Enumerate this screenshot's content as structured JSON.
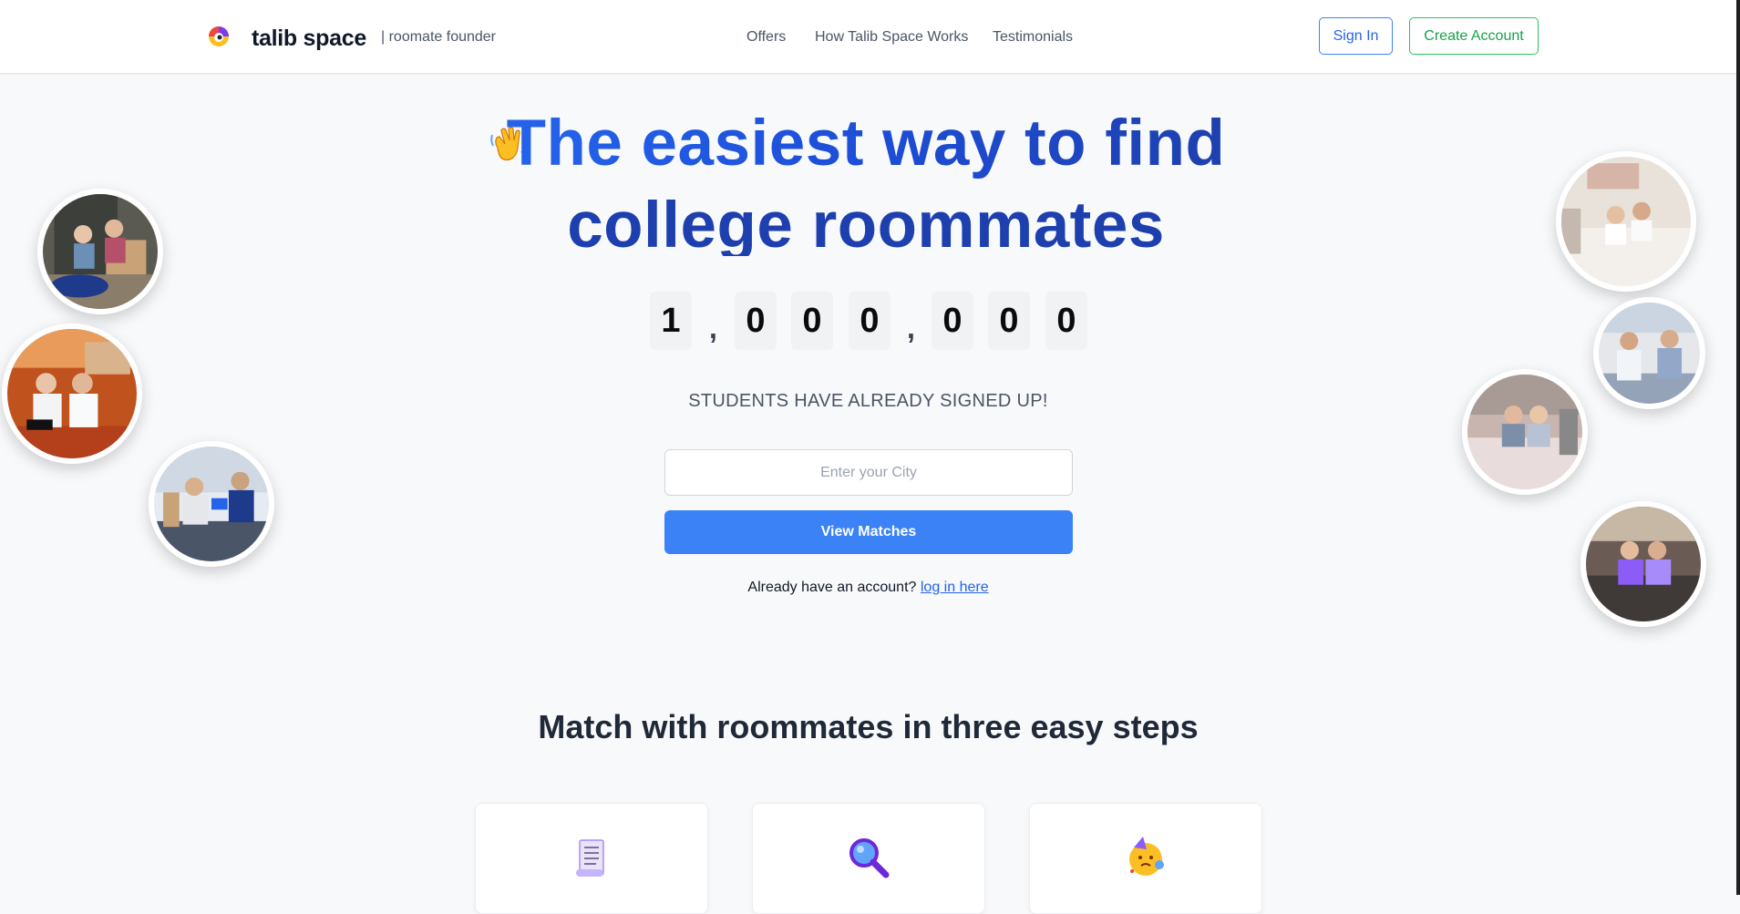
{
  "header": {
    "brand": "talib space",
    "tagline": "| roomate founder",
    "nav": [
      "Offers",
      "How Talib Space Works",
      "Testimonials"
    ],
    "sign_in": "Sign In",
    "create_account": "Create Account"
  },
  "hero": {
    "title_line1": "The easiest way to find",
    "title_line2": "college roommates",
    "counter_digits": [
      "1",
      ",",
      "0",
      "0",
      "0",
      ",",
      "0",
      "0",
      "0"
    ],
    "signed_up": "STUDENTS HAVE ALREADY SIGNED UP!",
    "city_placeholder": "Enter your City",
    "view_matches": "View Matches",
    "login_prefix": "Already have an account?",
    "login_link": "log in here"
  },
  "steps": {
    "title": "Match with roommates in three easy steps",
    "icons": [
      "scroll-icon",
      "magnifier-icon",
      "party-face-icon"
    ]
  },
  "colors": {
    "primary": "#3b82f6",
    "title_blue": "#1e40af",
    "success": "#22c55e"
  }
}
